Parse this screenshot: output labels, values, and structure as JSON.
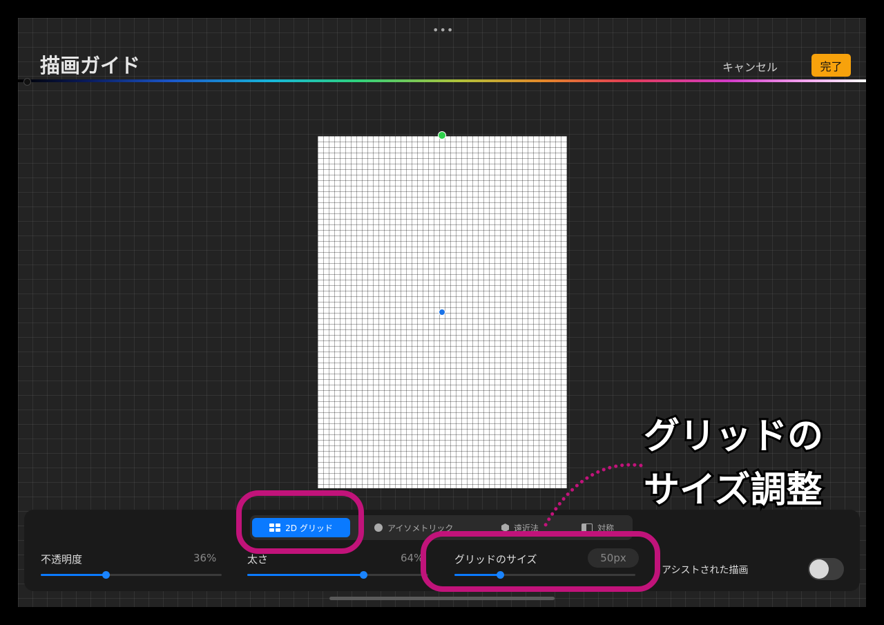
{
  "app": {
    "title": "描画ガイド",
    "cancel_label": "キャンセル",
    "done_label": "完了",
    "more_dots": "•••"
  },
  "colors": {
    "accent": "#0a7aff",
    "done_button": "#f7a20c",
    "annotation": "#c1137a",
    "top_handle": "#2ed14b"
  },
  "modes": [
    {
      "label": "2D グリッド",
      "icon": "grid-2d-icon",
      "selected": true
    },
    {
      "label": "アイソメトリック",
      "icon": "isometric-icon",
      "selected": false
    },
    {
      "label": "遠近法",
      "icon": "perspective-icon",
      "selected": false
    },
    {
      "label": "対称",
      "icon": "symmetry-icon",
      "selected": false
    }
  ],
  "controls": {
    "opacity": {
      "label": "不透明度",
      "value_text": "36%",
      "fraction": 0.36
    },
    "thickness": {
      "label": "太さ",
      "value_text": "64%",
      "fraction": 0.64
    },
    "grid_size": {
      "label": "グリッドのサイズ",
      "value_text": "50px",
      "fraction": 0.25
    },
    "assisted_drawing": {
      "label": "アシストされた描画",
      "enabled": false
    }
  },
  "annotation": {
    "line1": "グリッドの",
    "line2": "サイズ調整"
  }
}
